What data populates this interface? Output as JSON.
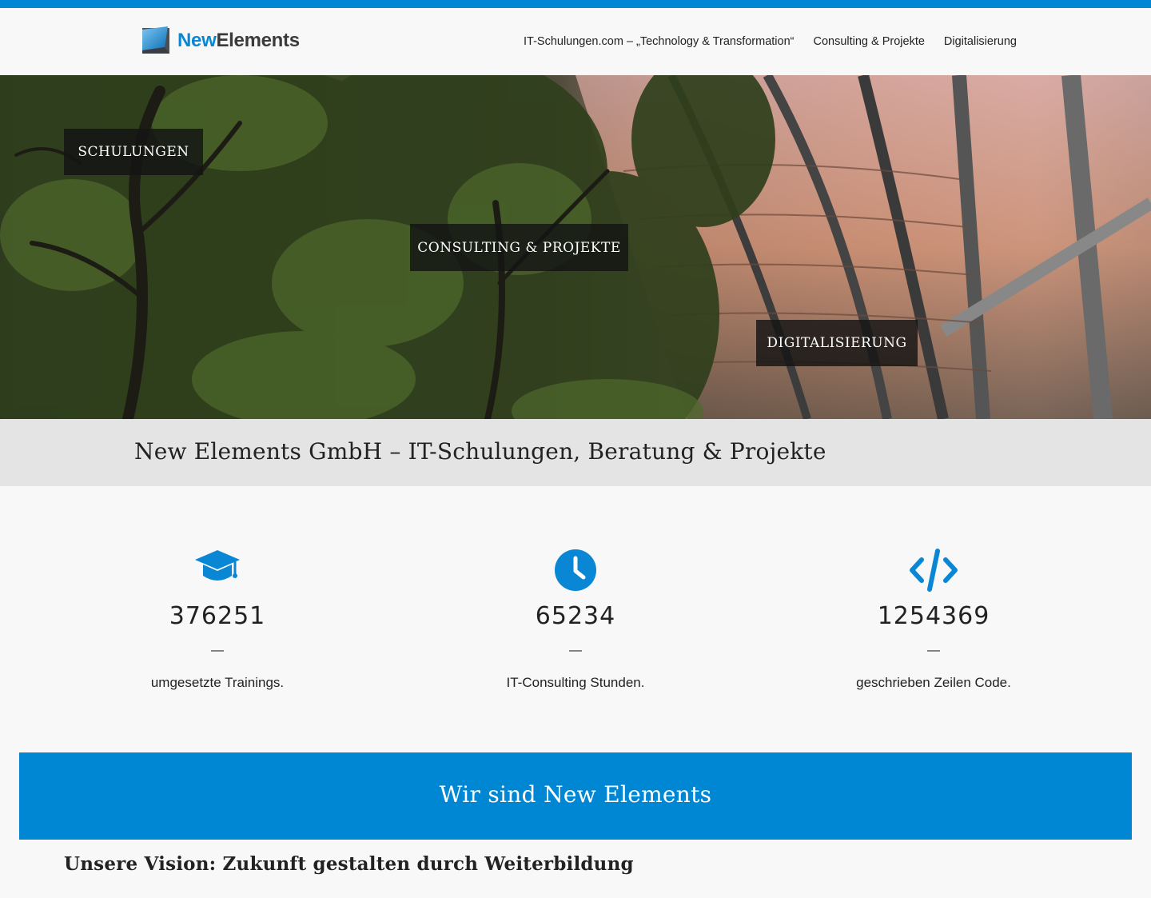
{
  "brand": {
    "logo_new": "New",
    "logo_elements": "Elements",
    "accent_color": "#0087d4"
  },
  "nav": {
    "items": [
      {
        "label": "IT-Schulungen.com – „Technology & Transformation“"
      },
      {
        "label": "Consulting & Projekte"
      },
      {
        "label": "Digitalisierung"
      }
    ]
  },
  "hero": {
    "buttons": [
      {
        "label": "SCHULUNGEN"
      },
      {
        "label": "CONSULTING & PROJEKTE"
      },
      {
        "label": "DIGITALISIERUNG"
      }
    ]
  },
  "page_title": "New Elements GmbH – IT-Schulungen, Beratung & Projekte",
  "stats": [
    {
      "icon": "graduation-cap-icon",
      "value": "376251",
      "dash": "—",
      "label": "umgesetzte Trainings."
    },
    {
      "icon": "clock-icon",
      "value": "65234",
      "dash": "—",
      "label": "IT-Consulting Stunden."
    },
    {
      "icon": "code-icon",
      "value": "1254369",
      "dash": "—",
      "label": "geschrieben Zeilen Code."
    }
  ],
  "banner": {
    "title": "Wir sind New Elements"
  },
  "vision_heading": "Unsere Vision: Zukunft gestalten durch Weiterbildung"
}
